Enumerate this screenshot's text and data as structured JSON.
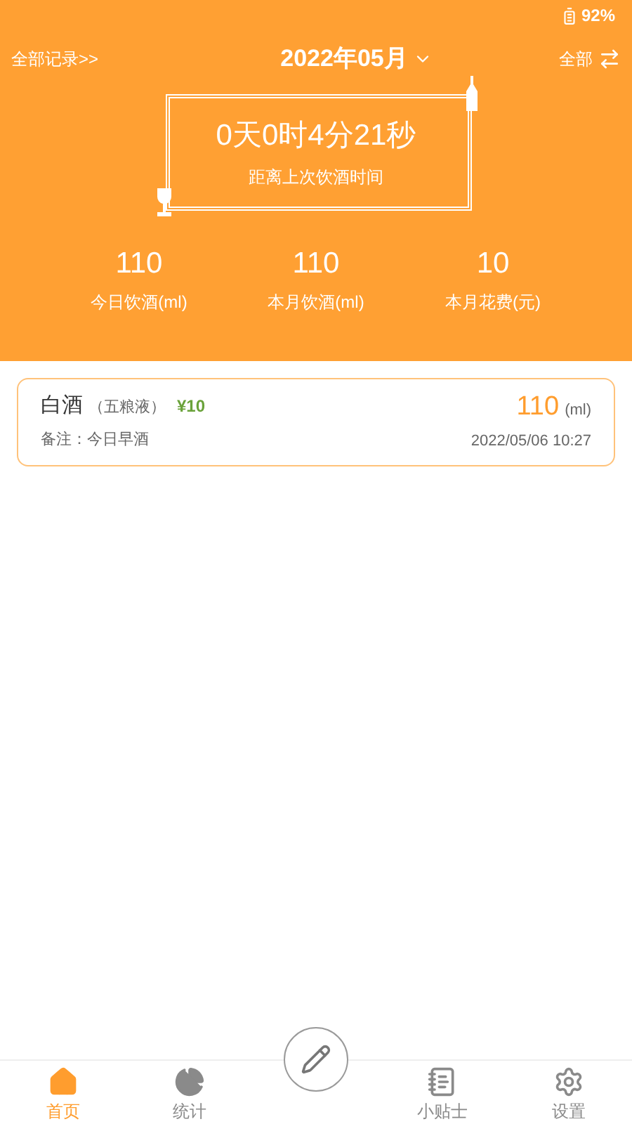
{
  "status_bar": {
    "battery": "92%"
  },
  "header": {
    "left_link": "全部记录>>",
    "month": "2022年05月",
    "filter": "全部"
  },
  "timer": {
    "elapsed": "0天0时4分21秒",
    "caption": "距离上次饮酒时间"
  },
  "stats": [
    {
      "value": "110",
      "label": "今日饮酒(ml)"
    },
    {
      "value": "110",
      "label": "本月饮酒(ml)"
    },
    {
      "value": "10",
      "label": "本月花费(元)"
    }
  ],
  "records": [
    {
      "name": "白酒",
      "brand": "（五粮液）",
      "price": "¥10",
      "amount": "110",
      "unit": "(ml)",
      "note": "备注：今日早酒",
      "time": "2022/05/06 10:27"
    }
  ],
  "nav": [
    {
      "kind": "home",
      "label": "首页",
      "selected": true
    },
    {
      "kind": "stats",
      "label": "统计",
      "selected": false
    },
    {
      "kind": "add"
    },
    {
      "kind": "tips",
      "label": "小贴士",
      "selected": false
    },
    {
      "kind": "settings",
      "label": "设置",
      "selected": false
    }
  ]
}
